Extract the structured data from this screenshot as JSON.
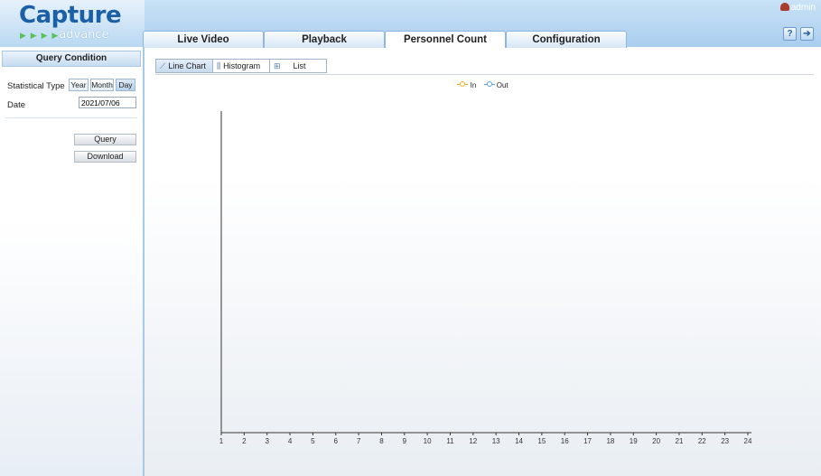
{
  "app": {
    "logo_main": "Capture",
    "logo_sub": "advance",
    "user": "admin"
  },
  "tabs": [
    {
      "label": "Live Video",
      "active": false
    },
    {
      "label": "Playback",
      "active": false
    },
    {
      "label": "Personnel Count",
      "active": true
    },
    {
      "label": "Configuration",
      "active": false
    }
  ],
  "query": {
    "title": "Query Condition",
    "stat_type_label": "Statistical Type",
    "stat_types": [
      "Year",
      "Month",
      "Day"
    ],
    "stat_type_selected": "Day",
    "date_label": "Date",
    "date_value": "2021/07/06",
    "query_button": "Query",
    "download_button": "Download"
  },
  "view": {
    "options": [
      "Line Chart",
      "Histogram",
      "List"
    ],
    "selected": "Line Chart"
  },
  "chart_data": {
    "type": "line",
    "x": [
      "1",
      "2",
      "3",
      "4",
      "5",
      "6",
      "7",
      "8",
      "9",
      "10",
      "11",
      "12",
      "13",
      "14",
      "15",
      "16",
      "17",
      "18",
      "19",
      "20",
      "21",
      "22",
      "23",
      "24"
    ],
    "series": [
      {
        "name": "In",
        "values": [],
        "color": "#f0b429"
      },
      {
        "name": "Out",
        "values": [],
        "color": "#5aa4e6"
      }
    ],
    "legend_position": "top-center",
    "grid": false
  }
}
